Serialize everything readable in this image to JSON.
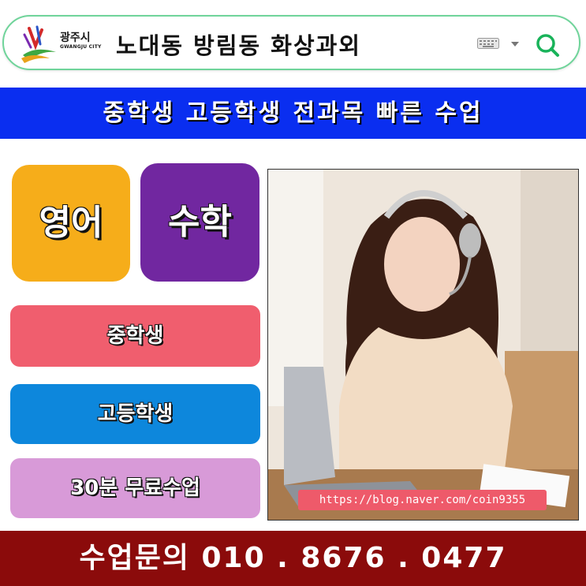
{
  "search": {
    "logo_text_kr": "광주시",
    "logo_text_en": "GWANGJU CITY",
    "query": "노대동 방림동 화상과외",
    "keyboard_icon": "keyboard-icon",
    "dropdown_icon": "caret-down-icon",
    "search_icon": "search-icon",
    "accent_color": "#19b35a"
  },
  "banner": {
    "text": "중학생 고등학생 전과목 빠른 수업",
    "color": "#0a2ef0"
  },
  "subjects": {
    "english": "영어",
    "math": "수학"
  },
  "levels": {
    "middle": "중학생",
    "high": "고등학생",
    "free_trial": "30분 무료수업"
  },
  "photo": {
    "url": "https://blog.naver.com/coin9355"
  },
  "footer": {
    "text": "수업문의 010 . 8676 . 0477",
    "color": "#8b0b0b"
  }
}
